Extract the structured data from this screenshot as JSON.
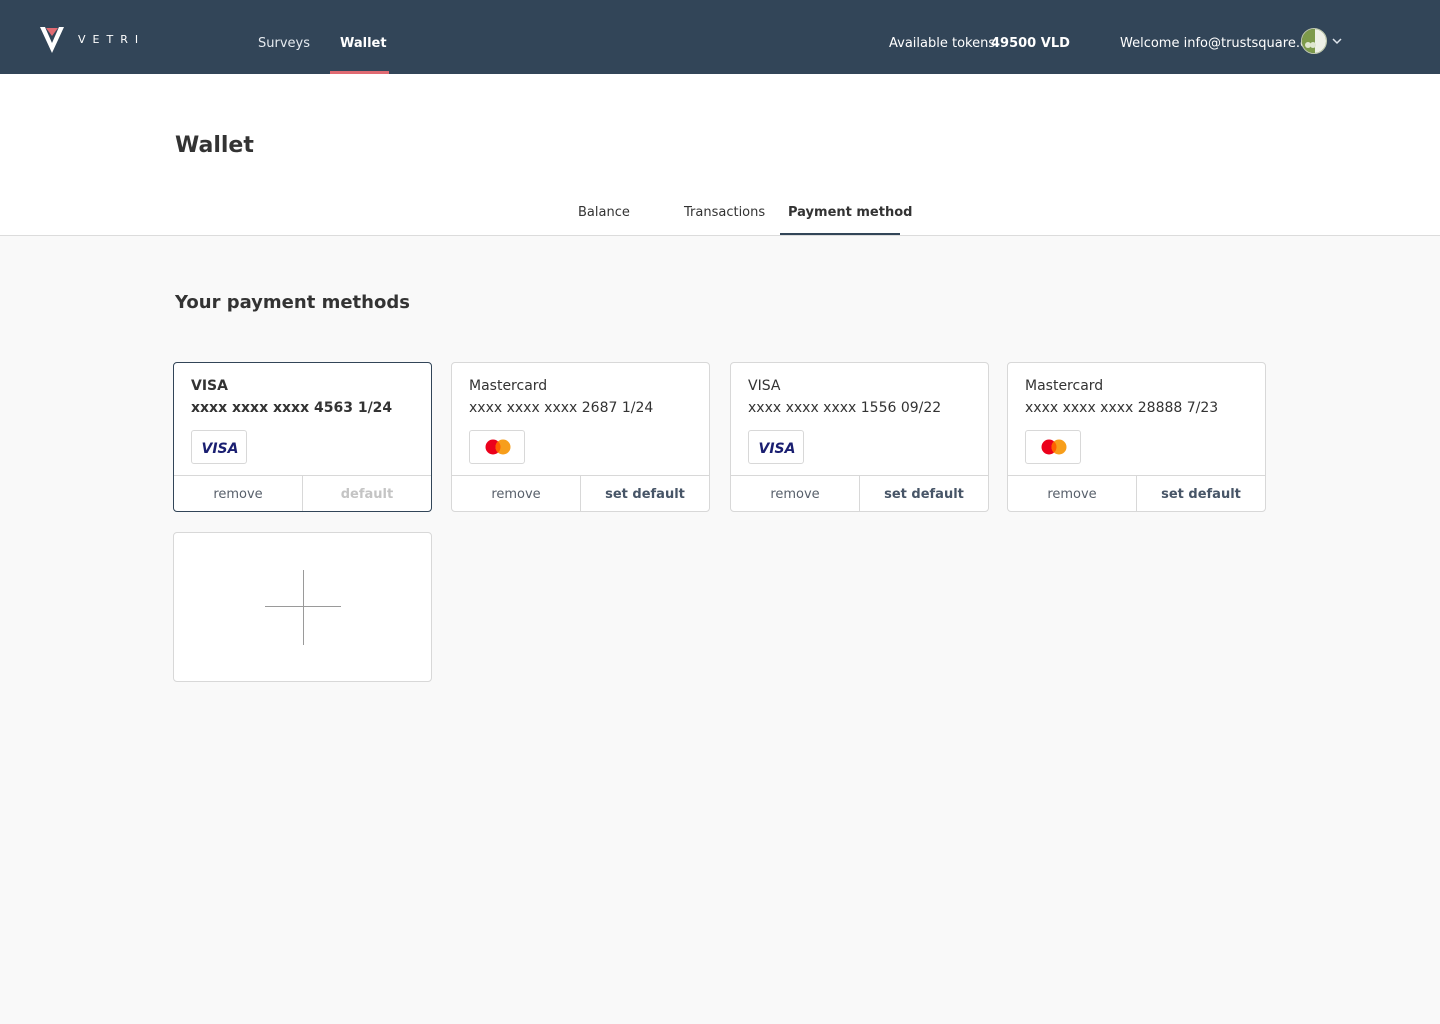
{
  "app": {
    "logo_text": "VETRI"
  },
  "nav": {
    "items": [
      {
        "label": "Surveys",
        "active": false
      },
      {
        "label": "Wallet",
        "active": true
      }
    ]
  },
  "account": {
    "tokens_label": "Available tokens:",
    "tokens_value": "49500 VLD",
    "welcome": "Welcome info@trustsquare.ch"
  },
  "page": {
    "title": "Wallet",
    "tabs": [
      {
        "label": "Balance",
        "active": false
      },
      {
        "label": "Transactions",
        "active": false
      },
      {
        "label": "Payment method",
        "active": true
      }
    ]
  },
  "payment_methods": {
    "title": "Your payment methods",
    "cards": [
      {
        "brand": "VISA",
        "number": "xxxx xxxx xxxx 4563 1/24",
        "logo": "visa-logo",
        "selected": true,
        "remove_label": "remove",
        "default_label": "default"
      },
      {
        "brand": "Mastercard",
        "number": "xxxx xxxx xxxx 2687 1/24",
        "logo": "mastercard-logo",
        "selected": false,
        "remove_label": "remove",
        "default_label": "set default"
      },
      {
        "brand": "VISA",
        "number": "xxxx xxxx xxxx 1556 09/22",
        "logo": "visa-logo",
        "selected": false,
        "remove_label": "remove",
        "default_label": "set default"
      },
      {
        "brand": "Mastercard",
        "number": "xxxx xxxx xxxx 28888 7/23",
        "logo": "mastercard-logo",
        "selected": false,
        "remove_label": "remove",
        "default_label": "set default"
      }
    ],
    "add_icon": "plus-icon"
  },
  "colors": {
    "topbar": "#324558",
    "nav_accent": "#e06a72",
    "visa_blue": "#1a1f71",
    "mc_red": "#eb001b",
    "mc_orange": "#f79e1b"
  }
}
